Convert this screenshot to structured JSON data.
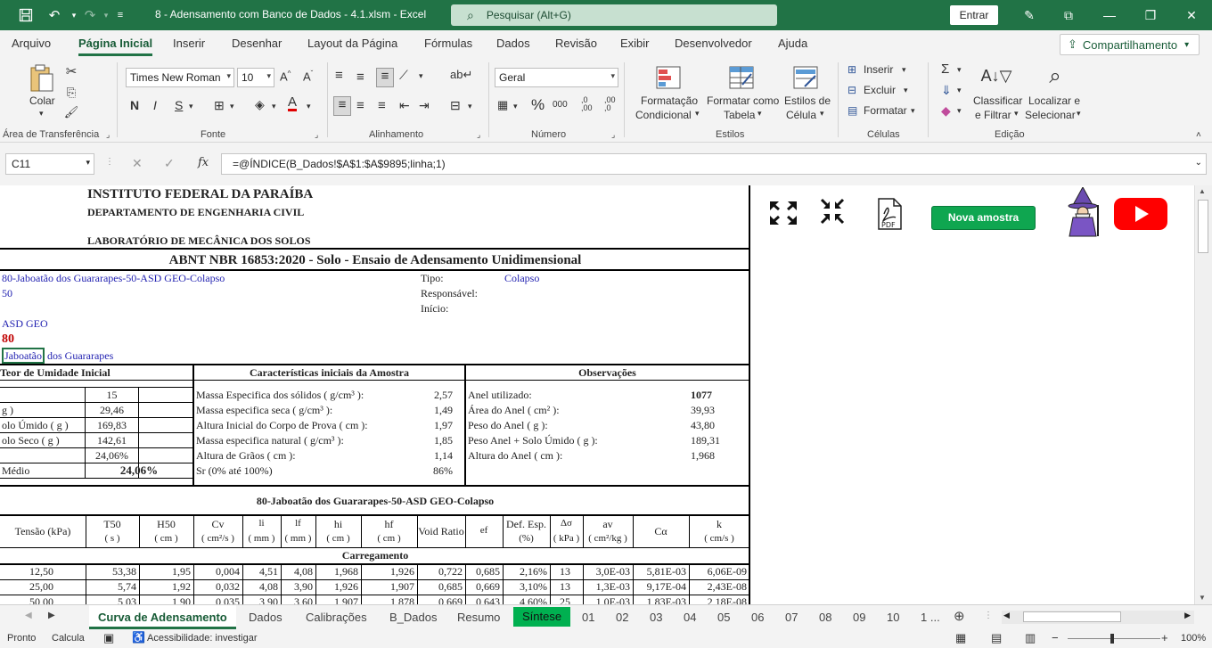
{
  "titlebar": {
    "title": "8 - Adensamento com Banco de Dados - 4.1.xlsm  -  Excel",
    "search_placeholder": "Pesquisar (Alt+G)",
    "signin": "Entrar"
  },
  "ribbon_tabs": [
    "Arquivo",
    "Página Inicial",
    "Inserir",
    "Desenhar",
    "Layout da Página",
    "Fórmulas",
    "Dados",
    "Revisão",
    "Exibir",
    "Desenvolvedor",
    "Ajuda"
  ],
  "share_label": "Compartilhamento",
  "ribbon": {
    "paste": "Colar",
    "font_name": "Times New Roman",
    "font_size": "10",
    "number_format": "Geral",
    "cond_format": [
      "Formatação",
      "Condicional"
    ],
    "format_table": [
      "Formatar como",
      "Tabela"
    ],
    "cell_styles": [
      "Estilos de",
      "Célula"
    ],
    "insert": "Inserir",
    "delete": "Excluir",
    "format": "Formatar",
    "sort": [
      "Classificar",
      "e Filtrar"
    ],
    "find": [
      "Localizar e",
      "Selecionar"
    ],
    "groups": [
      "Área de Transferência",
      "Fonte",
      "Alinhamento",
      "Número",
      "Estilos",
      "Células",
      "Edição"
    ]
  },
  "formula_bar": {
    "cell_ref": "C11",
    "formula": "=@ÍNDICE(B_Dados!$A$1:$A$9895;linha;1)"
  },
  "sheet": {
    "institute": "INSTITUTO FEDERAL DA PARAÍBA",
    "department": "DEPARTAMENTO DE ENGENHARIA CIVIL",
    "lab": "LABORATÓRIO DE MECÂNICA DOS SOLOS",
    "standard": "ABNT NBR 16853:2020 - Solo - Ensaio de Adensamento Unidimensional",
    "sample_name": "80-Jaboatão dos Guararapes-50-ASD GEO-Colapso",
    "sample_num": "50",
    "client": "ASD GEO",
    "sample_id": "80",
    "location_a": "Jaboatão",
    "location_b": " dos Guararapes",
    "tipo_label": "Tipo:",
    "tipo_value": "Colapso",
    "resp_label": "Responsável:",
    "inicio_label": "Início:",
    "humidity_title": "Teor de Umidade Inicial",
    "humidity_rows": [
      {
        "label": "",
        "value": "15"
      },
      {
        "label": "g )",
        "value": "29,46"
      },
      {
        "label": "olo Úmido ( g )",
        "value": "169,83"
      },
      {
        "label": "olo Seco ( g )",
        "value": "142,61"
      },
      {
        "label": "",
        "value": "24,06%"
      }
    ],
    "humidity_avg_label": "Médio",
    "humidity_avg": "24,06%",
    "char_title": "Características iniciais da Amostra",
    "char_rows": [
      {
        "label": "Massa Especifica dos sólidos ( g/cm³ ):",
        "value": "2,57"
      },
      {
        "label": "Massa especifica seca ( g/cm³ ):",
        "value": "1,49"
      },
      {
        "label": "Altura Inicial do Corpo de Prova ( cm ):",
        "value": "1,97"
      },
      {
        "label": "Massa especifica natural ( g/cm³ ):",
        "value": "1,85"
      },
      {
        "label": "Altura de Grãos ( cm ):",
        "value": "1,14"
      },
      {
        "label": "Sr (0% até 100%)",
        "value": "86%"
      }
    ],
    "obs_title": "Observações",
    "obs_rows": [
      {
        "label": "Anel utilizado:",
        "value": "1077"
      },
      {
        "label": "Área do Anel ( cm² ):",
        "value": "39,93"
      },
      {
        "label": "Peso do Anel ( g ):",
        "value": "43,80"
      },
      {
        "label": "Peso Anel + Solo Úmido ( g ):",
        "value": "189,31"
      },
      {
        "label": "Altura do Anel ( cm ):",
        "value": "1,968"
      }
    ],
    "table_title": "80-Jaboatão dos Guararapes-50-ASD GEO-Colapso",
    "headers": [
      {
        "top": "Tensão (kPa)",
        "bot": ""
      },
      {
        "top": "T50",
        "bot": "( s )"
      },
      {
        "top": "H50",
        "bot": "( cm )"
      },
      {
        "top": "Cv",
        "bot": "( cm²/s )"
      },
      {
        "top": "li",
        "bot": "( mm )"
      },
      {
        "top": "lf",
        "bot": "( mm )"
      },
      {
        "top": "hi",
        "bot": "( cm )"
      },
      {
        "top": "hf",
        "bot": "( cm )"
      },
      {
        "top": "Void Ratio",
        "bot": ""
      },
      {
        "top": "ef",
        "bot": ""
      },
      {
        "top": "Def. Esp.",
        "bot": "(%)"
      },
      {
        "top": "Δσ",
        "bot": "( kPa )"
      },
      {
        "top": "av",
        "bot": "( cm²/kg )"
      },
      {
        "top": "Cα",
        "bot": ""
      },
      {
        "top": "k",
        "bot": "( cm/s )"
      }
    ],
    "section_label": "Carregamento",
    "rows": [
      [
        "12,50",
        "53,38",
        "1,95",
        "0,004",
        "4,51",
        "4,08",
        "1,968",
        "1,926",
        "0,722",
        "0,685",
        "2,16%",
        "13",
        "3,0E-03",
        "5,81E-03",
        "6,06E-09"
      ],
      [
        "25,00",
        "5,74",
        "1,92",
        "0,032",
        "4,08",
        "3,90",
        "1,926",
        "1,907",
        "0,685",
        "0,669",
        "3,10%",
        "13",
        "1,3E-03",
        "9,17E-04",
        "2,43E-08"
      ],
      [
        "50,00",
        "5,03",
        "1,90",
        "0,035",
        "3,90",
        "3,60",
        "1,907",
        "1,878",
        "0,669",
        "0,643",
        "4,60%",
        "25",
        "1,0E-03",
        "1,83E-03",
        "2,18E-08"
      ]
    ]
  },
  "panel": {
    "new_sample": "Nova amostra",
    "pdf": "PDF"
  },
  "sheet_tabs": [
    "Curva de Adensamento",
    "Dados",
    "Calibrações",
    "B_Dados",
    "Resumo",
    "Síntese",
    "01",
    "02",
    "03",
    "04",
    "05",
    "06",
    "07",
    "08",
    "09",
    "10",
    "1 ..."
  ],
  "status": {
    "ready": "Pronto",
    "calc": "Calcula",
    "accessibility": "Acessibilidade: investigar",
    "zoom": "100%"
  },
  "colors": {
    "excel_green": "#217346",
    "blue_text": "#1f1fb0",
    "red_text": "#c00000",
    "button_green": "#0fa650"
  }
}
